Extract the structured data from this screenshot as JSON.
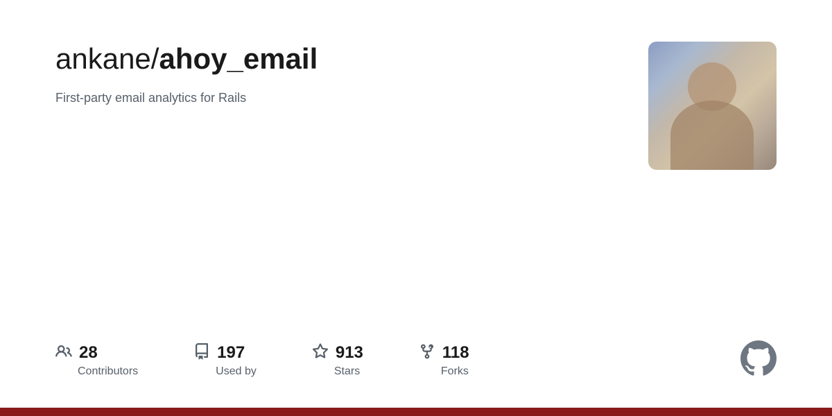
{
  "header": {
    "owner": "ankane/",
    "repo": "ahoy_email",
    "description": "First-party email analytics for Rails"
  },
  "stats": {
    "contributors": {
      "count": "28",
      "label": "Contributors"
    },
    "used_by": {
      "count": "197",
      "label": "Used by"
    },
    "stars": {
      "count": "913",
      "label": "Stars"
    },
    "forks": {
      "count": "118",
      "label": "Forks"
    }
  }
}
